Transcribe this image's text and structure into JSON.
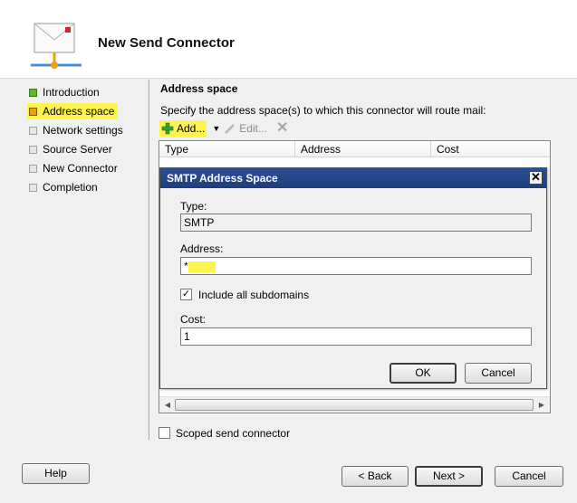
{
  "header": {
    "title": "New Send Connector",
    "icon": "email-connector-icon"
  },
  "nav": {
    "items": [
      {
        "label": "Introduction",
        "state": "done"
      },
      {
        "label": "Address space",
        "state": "active"
      },
      {
        "label": "Network settings",
        "state": "pending"
      },
      {
        "label": "Source Server",
        "state": "pending"
      },
      {
        "label": "New Connector",
        "state": "pending"
      },
      {
        "label": "Completion",
        "state": "pending"
      }
    ]
  },
  "main": {
    "section_title": "Address space",
    "instruction": "Specify the address space(s) to which this connector will route mail:",
    "toolbar": {
      "add_label": "Add...",
      "edit_label": "Edit...",
      "delete_icon": "x-icon"
    },
    "columns": [
      "Type",
      "Address",
      "Cost"
    ],
    "scoped_label": "Scoped send connector",
    "scoped_checked": false
  },
  "dialog": {
    "title": "SMTP Address Space",
    "type_label": "Type:",
    "type_value": "SMTP",
    "address_label": "Address:",
    "address_value": "*",
    "include_subdomains_label": "Include all subdomains",
    "include_subdomains_checked": true,
    "cost_label": "Cost:",
    "cost_value": "1",
    "ok_label": "OK",
    "cancel_label": "Cancel"
  },
  "footer": {
    "help_label": "Help",
    "back_label": "< Back",
    "next_label": "Next >",
    "cancel_label": "Cancel"
  },
  "colors": {
    "highlight": "#fff44f",
    "titlebar": "#2c4e94",
    "done": "#5cb82e",
    "active": "#e8a20b"
  }
}
